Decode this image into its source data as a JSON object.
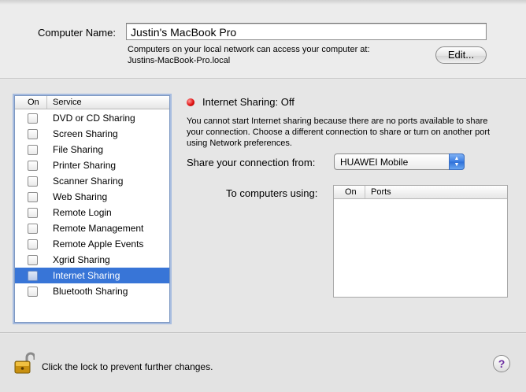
{
  "computer_name": {
    "label": "Computer Name:",
    "value": "Justin's MacBook Pro",
    "info_line1": "Computers on your local network can access your computer at:",
    "info_line2": "Justins-MacBook-Pro.local",
    "edit_label": "Edit..."
  },
  "services": {
    "header_on": "On",
    "header_service": "Service",
    "items": [
      {
        "label": "DVD or CD Sharing",
        "checked": false,
        "selected": false
      },
      {
        "label": "Screen Sharing",
        "checked": false,
        "selected": false
      },
      {
        "label": "File Sharing",
        "checked": false,
        "selected": false
      },
      {
        "label": "Printer Sharing",
        "checked": false,
        "selected": false
      },
      {
        "label": "Scanner Sharing",
        "checked": false,
        "selected": false
      },
      {
        "label": "Web Sharing",
        "checked": false,
        "selected": false
      },
      {
        "label": "Remote Login",
        "checked": false,
        "selected": false
      },
      {
        "label": "Remote Management",
        "checked": false,
        "selected": false
      },
      {
        "label": "Remote Apple Events",
        "checked": false,
        "selected": false
      },
      {
        "label": "Xgrid Sharing",
        "checked": false,
        "selected": false
      },
      {
        "label": "Internet Sharing",
        "checked": false,
        "selected": true
      },
      {
        "label": "Bluetooth Sharing",
        "checked": false,
        "selected": false
      }
    ]
  },
  "detail": {
    "status": "Internet Sharing: Off",
    "status_color": "#e01010",
    "description": "You cannot start Internet sharing because there are no ports available to share your connection. Choose a different connection to share or turn on another port using Network preferences.",
    "share_from_label": "Share your connection from:",
    "share_from_value": "HUAWEI Mobile",
    "to_computers_label": "To computers using:",
    "ports_header_on": "On",
    "ports_header_ports": "Ports"
  },
  "footer": {
    "lock_text": "Click the lock to prevent further changes.",
    "lock_icon": "unlocked-padlock-icon",
    "help_label": "?"
  },
  "colors": {
    "selection": "#3875d7",
    "popup_arrows": "#3c7ee3",
    "help_glyph": "#6a2aa0"
  }
}
